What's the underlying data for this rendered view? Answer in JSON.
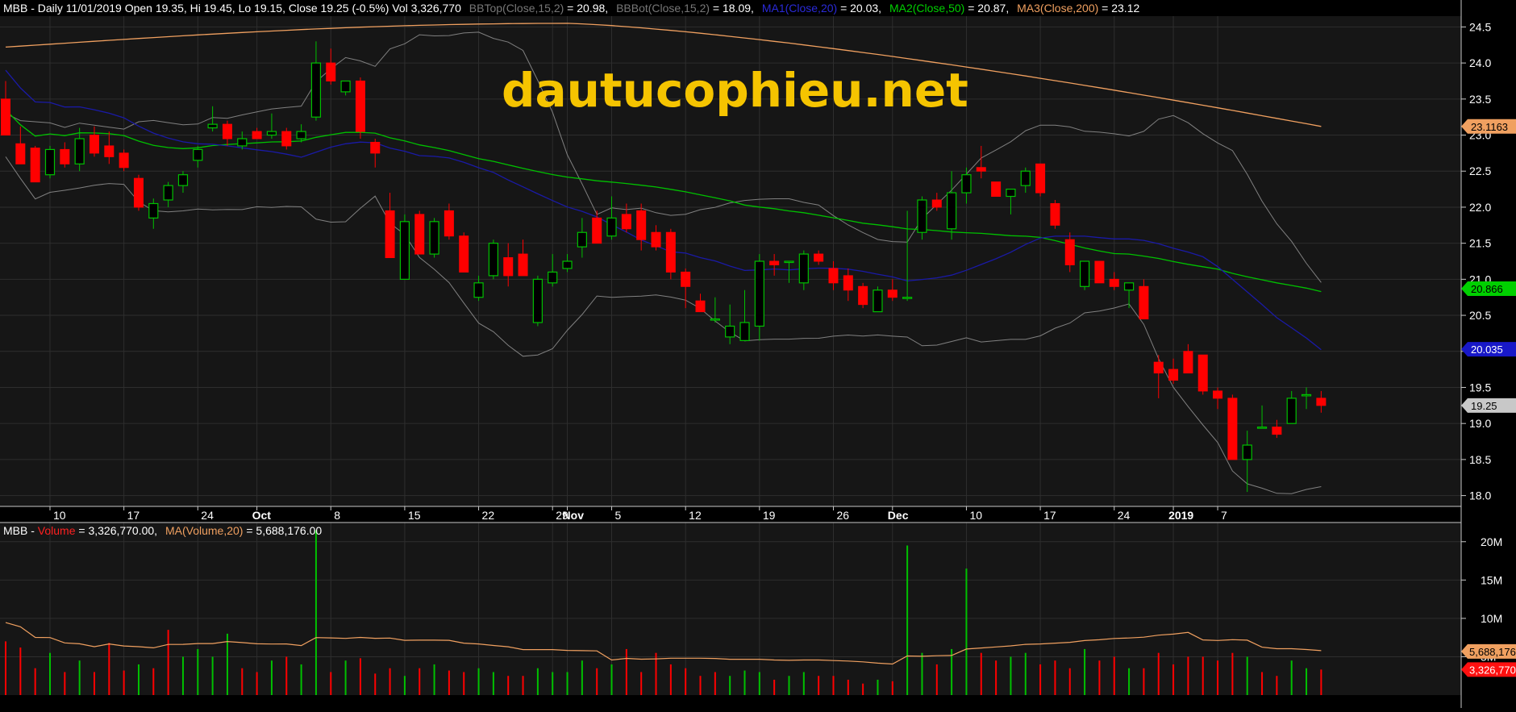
{
  "price_header": {
    "prefix": "MBB - Daily 11/01/2019 Open 19.35, Hi 19.45, Lo 19.15, Close 19.25 (-0.5%) Vol 3,326,770",
    "bbtop_name": "BBTop(Close,15,2)",
    "bbtop_value": " = 20.98,",
    "bbbot_name": "BBBot(Close,15,2)",
    "bbbot_value": " = 18.09,",
    "ma1_name": "MA1(Close,20)",
    "ma1_value": " = 20.03,",
    "ma2_name": "MA2(Close,50)",
    "ma2_value": " = 20.87,",
    "ma3_name": "MA3(Close,200)",
    "ma3_value": " = 23.12"
  },
  "volume_header": {
    "prefix": "MBB - ",
    "volume_name": "Volume",
    "volume_value": " = 3,326,770.00,",
    "mavol_name": "MA(Volume,20)",
    "mavol_value": " = 5,688,176.00"
  },
  "watermark": "dautucophieu.net",
  "price_axis_ticks": [
    "24.5",
    "24.0",
    "23.5",
    "23.0",
    "22.5",
    "22.0",
    "21.5",
    "21.0",
    "20.5",
    "20.0",
    "19.5",
    "19.0",
    "18.5",
    "18.0"
  ],
  "volume_axis_ticks": [
    "20M",
    "15M",
    "10M",
    "5M"
  ],
  "badges": {
    "ma3": "23.1163",
    "ma2": "20.866",
    "ma1": "20.035",
    "close": "19.25",
    "mavol": "5,688,176",
    "volume": "3,326,770"
  },
  "colors": {
    "up": "#00c000",
    "down": "#ff0000",
    "ma1": "#1a1aa6",
    "ma2": "#00c000",
    "ma3": "#f0a060",
    "bollinger": "#808080",
    "grid": "#2e2e2e",
    "volume_ma": "#f0a060",
    "watermark": "#f5c400"
  },
  "chart_data": {
    "type": "candlestick",
    "symbol": "MBB",
    "interval": "Daily",
    "price_ylim": [
      17.85,
      24.65
    ],
    "volume_ylim": [
      0,
      22500000
    ],
    "x_tick_labels": [
      "10",
      "17",
      "24",
      "Oct",
      "8",
      "15",
      "22",
      "29",
      "Nov",
      "5",
      "12",
      "19",
      "26",
      "Dec",
      "10",
      "17",
      "24",
      "2019",
      "7"
    ],
    "candles": [
      [
        23.5,
        23.75,
        23.05,
        23.0
      ],
      [
        22.88,
        23.12,
        22.65,
        22.6
      ],
      [
        22.82,
        22.85,
        22.4,
        22.35
      ],
      [
        22.45,
        22.85,
        22.4,
        22.8
      ],
      [
        22.8,
        22.9,
        22.55,
        22.6
      ],
      [
        22.6,
        23.1,
        22.5,
        22.95
      ],
      [
        23.0,
        23.12,
        22.7,
        22.75
      ],
      [
        22.85,
        23.05,
        22.6,
        22.7
      ],
      [
        22.75,
        22.8,
        22.5,
        22.55
      ],
      [
        22.4,
        22.45,
        21.95,
        22.0
      ],
      [
        21.85,
        22.12,
        21.7,
        22.05
      ],
      [
        22.1,
        22.35,
        22.0,
        22.3
      ],
      [
        22.3,
        22.5,
        22.2,
        22.45
      ],
      [
        22.65,
        22.85,
        22.55,
        22.8
      ],
      [
        23.1,
        23.4,
        23.05,
        23.15
      ],
      [
        23.15,
        23.2,
        22.85,
        22.95
      ],
      [
        22.85,
        23.05,
        22.8,
        22.95
      ],
      [
        23.05,
        23.1,
        22.95,
        22.95
      ],
      [
        23.0,
        23.3,
        22.95,
        23.05
      ],
      [
        23.05,
        23.1,
        22.8,
        22.85
      ],
      [
        22.95,
        23.15,
        22.9,
        23.05
      ],
      [
        23.25,
        24.3,
        23.2,
        24.0
      ],
      [
        24.0,
        24.2,
        23.7,
        23.75
      ],
      [
        23.6,
        23.75,
        23.55,
        23.75
      ],
      [
        23.75,
        23.8,
        22.95,
        23.05
      ],
      [
        22.9,
        22.95,
        22.55,
        22.75
      ],
      [
        21.95,
        22.2,
        21.35,
        21.3
      ],
      [
        21.0,
        21.9,
        21.0,
        21.8
      ],
      [
        21.9,
        21.95,
        21.35,
        21.35
      ],
      [
        21.35,
        21.85,
        21.3,
        21.8
      ],
      [
        21.95,
        22.05,
        21.55,
        21.6
      ],
      [
        21.6,
        21.65,
        21.1,
        21.1
      ],
      [
        20.75,
        21.05,
        20.7,
        20.95
      ],
      [
        21.05,
        21.55,
        21.0,
        21.5
      ],
      [
        21.3,
        21.5,
        20.9,
        21.05
      ],
      [
        21.35,
        21.55,
        21.2,
        21.05
      ],
      [
        20.4,
        21.05,
        20.35,
        21.0
      ],
      [
        20.95,
        21.35,
        20.9,
        21.1
      ],
      [
        21.15,
        21.35,
        21.1,
        21.25
      ],
      [
        21.45,
        21.85,
        21.3,
        21.65
      ],
      [
        21.85,
        21.95,
        21.6,
        21.5
      ],
      [
        21.6,
        22.15,
        21.55,
        21.85
      ],
      [
        21.9,
        22.05,
        21.65,
        21.7
      ],
      [
        21.95,
        22.05,
        21.4,
        21.55
      ],
      [
        21.65,
        21.75,
        21.4,
        21.45
      ],
      [
        21.65,
        21.7,
        21.0,
        21.1
      ],
      [
        21.1,
        21.15,
        20.6,
        20.9
      ],
      [
        20.7,
        20.8,
        20.55,
        20.55
      ],
      [
        20.45,
        20.75,
        20.4,
        20.45
      ],
      [
        20.2,
        20.65,
        20.1,
        20.35
      ],
      [
        20.15,
        20.85,
        20.15,
        20.4
      ],
      [
        20.35,
        21.35,
        20.15,
        21.25
      ],
      [
        21.25,
        21.35,
        21.05,
        21.2
      ],
      [
        21.25,
        21.25,
        20.95,
        21.25
      ],
      [
        20.95,
        21.4,
        20.85,
        21.35
      ],
      [
        21.35,
        21.4,
        21.2,
        21.25
      ],
      [
        21.15,
        21.25,
        20.85,
        20.95
      ],
      [
        21.05,
        21.15,
        20.7,
        20.85
      ],
      [
        20.9,
        20.95,
        20.6,
        20.65
      ],
      [
        20.55,
        20.9,
        20.55,
        20.85
      ],
      [
        20.85,
        21.0,
        20.7,
        20.75
      ],
      [
        20.75,
        21.95,
        20.7,
        20.75
      ],
      [
        21.65,
        22.15,
        21.55,
        22.1
      ],
      [
        22.1,
        22.2,
        21.95,
        22.0
      ],
      [
        21.7,
        22.5,
        21.55,
        22.2
      ],
      [
        22.2,
        22.55,
        22.05,
        22.45
      ],
      [
        22.55,
        22.85,
        22.4,
        22.5
      ],
      [
        22.35,
        22.35,
        22.15,
        22.15
      ],
      [
        22.15,
        22.25,
        21.9,
        22.25
      ],
      [
        22.3,
        22.55,
        22.2,
        22.5
      ],
      [
        22.6,
        22.6,
        22.15,
        22.2
      ],
      [
        22.05,
        22.1,
        21.7,
        21.75
      ],
      [
        21.55,
        21.65,
        21.1,
        21.2
      ],
      [
        20.9,
        21.25,
        20.85,
        21.25
      ],
      [
        21.25,
        21.25,
        20.95,
        20.95
      ],
      [
        21.0,
        21.1,
        20.85,
        20.9
      ],
      [
        20.85,
        20.95,
        20.6,
        20.95
      ],
      [
        20.9,
        21.0,
        20.45,
        20.45
      ],
      [
        19.85,
        19.95,
        19.35,
        19.7
      ],
      [
        19.75,
        19.9,
        19.55,
        19.6
      ],
      [
        20.0,
        20.1,
        19.75,
        19.7
      ],
      [
        19.95,
        19.95,
        19.4,
        19.45
      ],
      [
        19.45,
        19.5,
        19.2,
        19.35
      ],
      [
        19.35,
        19.4,
        18.5,
        18.5
      ],
      [
        18.5,
        18.9,
        18.05,
        18.7
      ],
      [
        18.95,
        19.25,
        18.95,
        18.95
      ],
      [
        18.95,
        19.05,
        18.8,
        18.85
      ],
      [
        19.0,
        19.45,
        19.0,
        19.35
      ],
      [
        19.4,
        19.5,
        19.2,
        19.4
      ],
      [
        19.35,
        19.45,
        19.15,
        19.25
      ]
    ],
    "volume_millions": [
      7.0,
      6.2,
      3.5,
      5.5,
      3.0,
      4.5,
      3.0,
      6.8,
      3.2,
      4.0,
      3.5,
      8.5,
      5.0,
      6.0,
      5.0,
      8.0,
      3.5,
      3.0,
      4.5,
      5.0,
      4.0,
      6.5,
      3.0,
      4.5,
      4.8,
      2.8,
      3.5,
      2.5,
      3.5,
      4.0,
      3.2,
      3.0,
      3.5,
      3.0,
      2.5,
      2.5,
      3.5,
      3.0,
      3.0,
      4.5,
      3.5,
      4.0,
      6.0,
      3.0,
      5.5,
      4.0,
      3.5,
      2.5,
      3.0,
      2.5,
      3.2,
      3.0,
      2.0,
      2.5,
      3.0,
      2.5,
      2.5,
      2.0,
      1.5,
      2.0,
      1.8,
      6.0,
      5.5,
      4.0,
      6.0,
      5.0,
      5.5,
      4.5,
      5.0,
      5.5,
      4.0,
      4.5,
      3.5,
      6.0,
      4.5,
      5.0,
      3.5,
      3.5,
      5.5,
      4.0,
      5.0,
      5.0,
      4.5,
      5.5,
      5.0,
      3.0,
      2.5,
      4.5,
      3.5,
      3.33
    ],
    "volume_direction": [
      -1,
      -1,
      -1,
      1,
      -1,
      1,
      -1,
      -1,
      -1,
      1,
      -1,
      -1,
      1,
      1,
      1,
      1,
      -1,
      -1,
      1,
      -1,
      1,
      1,
      -1,
      1,
      -1,
      -1,
      -1,
      1,
      -1,
      1,
      -1,
      -1,
      1,
      1,
      -1,
      -1,
      1,
      1,
      1,
      1,
      -1,
      1,
      -1,
      -1,
      -1,
      -1,
      -1,
      -1,
      -1,
      1,
      1,
      1,
      -1,
      1,
      1,
      -1,
      -1,
      -1,
      -1,
      1,
      -1,
      1,
      1,
      -1,
      1,
      1,
      -1,
      -1,
      1,
      1,
      -1,
      -1,
      -1,
      1,
      -1,
      -1,
      1,
      -1,
      -1,
      -1,
      -1,
      -1,
      -1,
      -1,
      1,
      -1,
      -1,
      1,
      1,
      -1
    ],
    "volume_spikes": {
      "21": 21.5,
      "61": 19.5,
      "65": 16.5
    },
    "indicator_latest": {
      "BBTop": 20.98,
      "BBBot": 18.09,
      "MA20": 20.03,
      "MA50": 20.87,
      "MA200": 23.12,
      "MA_Volume20": 5688176
    }
  }
}
